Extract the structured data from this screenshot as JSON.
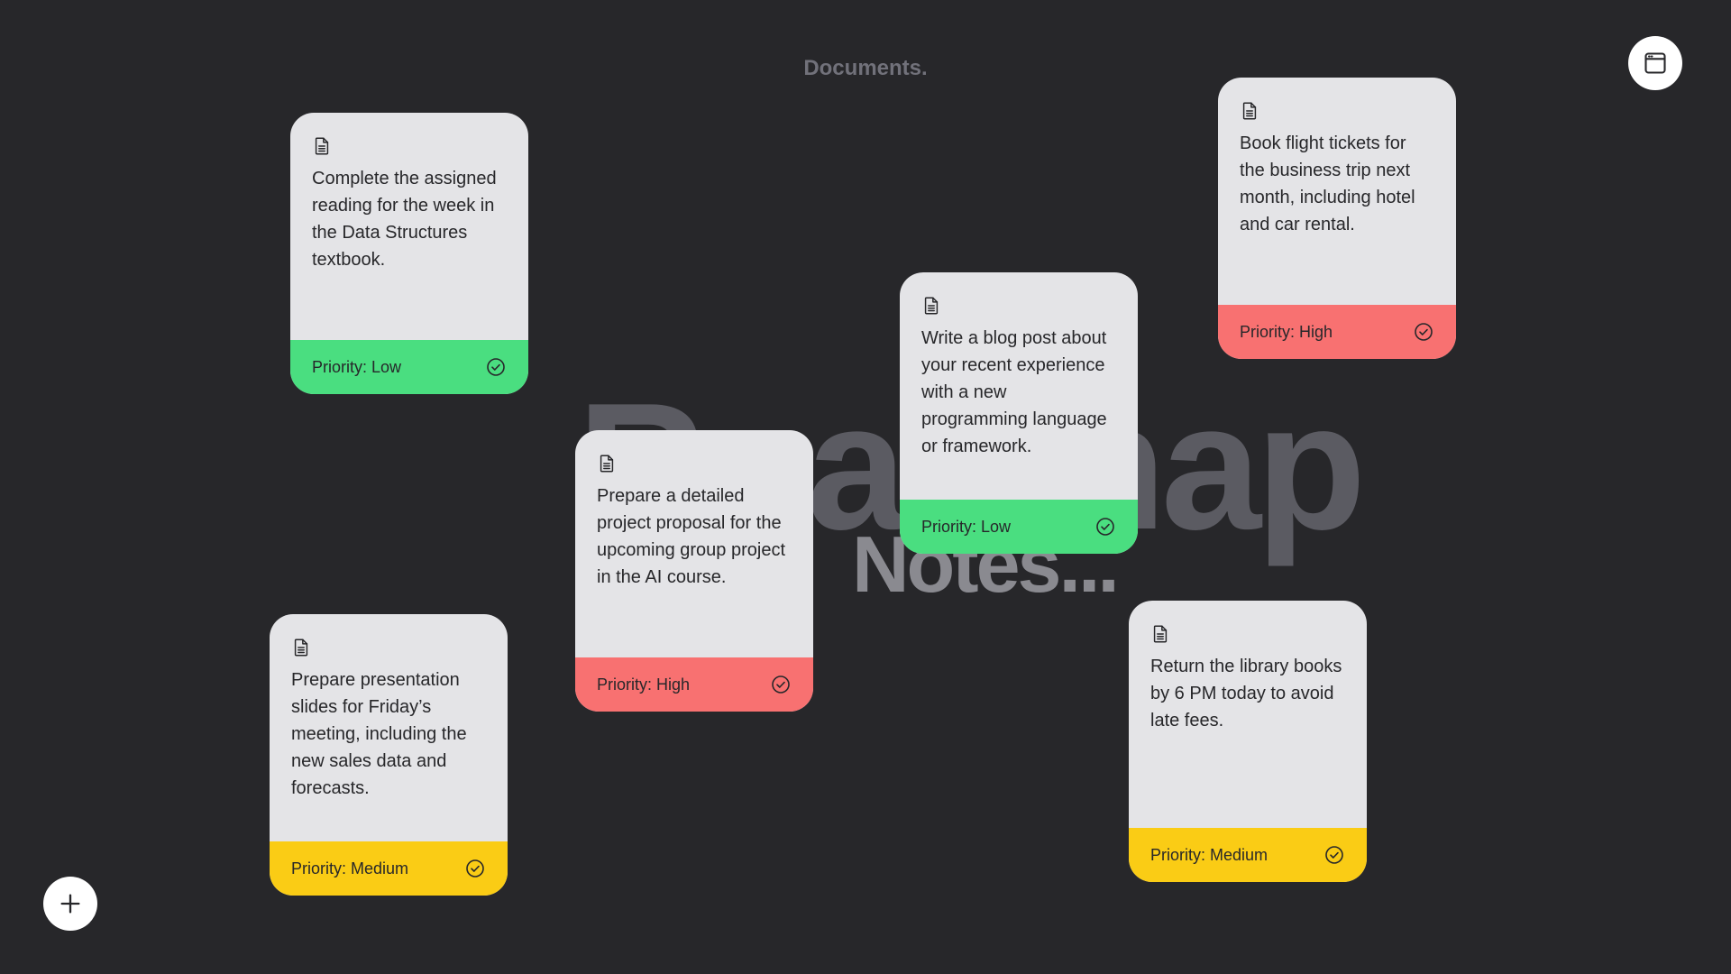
{
  "header": {
    "title": "Documents."
  },
  "background": {
    "big": "Roadmap",
    "small": "Notes..."
  },
  "notes": [
    {
      "text": "Complete the assigned reading for the week in the Data Structures textbook.",
      "priority": "Priority: Low",
      "color": "#4ade80"
    },
    {
      "text": "Book flight tickets for the business trip next month, including hotel and car rental.",
      "priority": "Priority: High",
      "color": "#f87171"
    },
    {
      "text": "Write a blog post about your recent experience with a new programming language or framework.",
      "priority": "Priority: Low",
      "color": "#4ade80"
    },
    {
      "text": "Prepare a detailed project proposal for the upcoming group project in the AI course.",
      "priority": "Priority: High",
      "color": "#f87171"
    },
    {
      "text": "Prepare presentation slides for Friday’s meeting, including the new sales data and forecasts.",
      "priority": "Priority: Medium",
      "color": "#facc15"
    },
    {
      "text": "Return the library books by 6 PM today to avoid late fees.",
      "priority": "Priority: Medium",
      "color": "#facc15"
    }
  ],
  "icons": {
    "top_right": "window-icon",
    "bottom_left": "plus-icon",
    "note": "document-icon",
    "done": "check-circle-icon"
  }
}
